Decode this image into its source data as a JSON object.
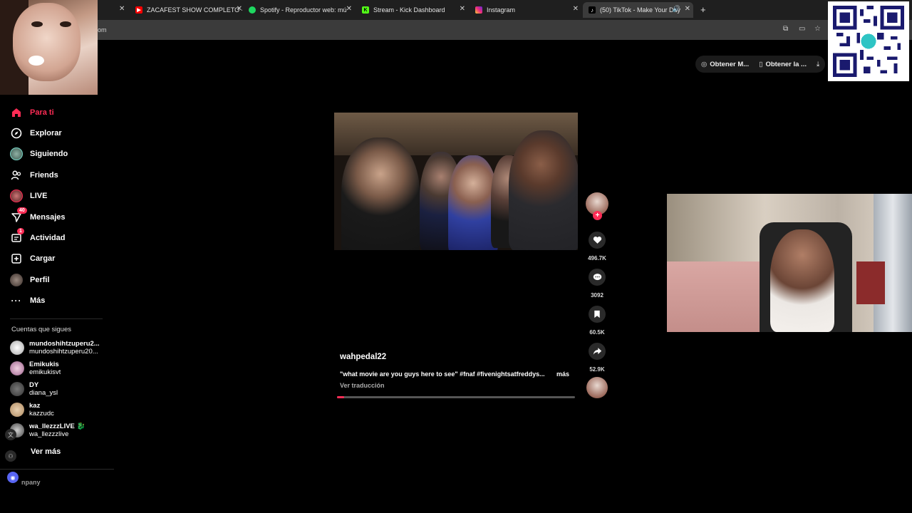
{
  "browser": {
    "tabs": [
      {
        "title": "ZACAFEST SHOW COMPLETO -",
        "icon": "youtube-icon",
        "color": "#ff0000"
      },
      {
        "title": "Spotify - Reproductor web: mú",
        "icon": "spotify-icon",
        "color": "#1ed760"
      },
      {
        "title": "Stream - Kick Dashboard",
        "icon": "kick-icon",
        "color": "#53fc18"
      },
      {
        "title": "Instagram",
        "icon": "instagram-icon",
        "color": "#e1306c"
      },
      {
        "title": "(50) TikTok - Make Your Day",
        "icon": "tiktok-icon",
        "color": "#ffffff",
        "active": true
      }
    ],
    "url_fragment": "om"
  },
  "header": {
    "buttons": [
      {
        "label": "Obtener M...",
        "icon": "coin-icon"
      },
      {
        "label": "Obtener la ...",
        "icon": "phone-icon"
      }
    ]
  },
  "sidebar": {
    "items": [
      {
        "label": "Para ti",
        "icon": "home-icon",
        "active": true
      },
      {
        "label": "Explorar",
        "icon": "compass-icon"
      },
      {
        "label": "Siguiendo",
        "icon": "following-avatar-icon"
      },
      {
        "label": "Friends",
        "icon": "friends-icon"
      },
      {
        "label": "LIVE",
        "icon": "live-icon"
      },
      {
        "label": "Mensajes",
        "icon": "send-icon",
        "badge": "40"
      },
      {
        "label": "Actividad",
        "icon": "inbox-icon",
        "badge": "1"
      },
      {
        "label": "Cargar",
        "icon": "upload-icon"
      },
      {
        "label": "Perfil",
        "icon": "profile-avatar-icon"
      },
      {
        "label": "Más",
        "icon": "more-icon"
      }
    ],
    "following_title": "Cuentas que sigues",
    "following": [
      {
        "name": "mundoshihtzuperu2...",
        "handle": "mundoshihtzuperu20..."
      },
      {
        "name": "Emikukis",
        "handle": "emikukisvt"
      },
      {
        "name": "DY",
        "handle": "diana_ysl"
      },
      {
        "name": "kaz",
        "handle": "kazzudc"
      },
      {
        "name": "wa_llezzzLIVE 🐉",
        "handle": "wa_llezzzlive"
      }
    ],
    "see_more": "Ver más",
    "company": "npany"
  },
  "post": {
    "author": "wahpedal22",
    "caption": "\"what movie are you guys here to see\" #fnaf #fivenightsatfreddys...",
    "more": "más",
    "translate": "Ver traducción",
    "progress": 0.03,
    "likes": "496.7K",
    "comments": "3092",
    "saves": "60.5K",
    "shares": "52.9K"
  },
  "accent": "#fe2c55"
}
